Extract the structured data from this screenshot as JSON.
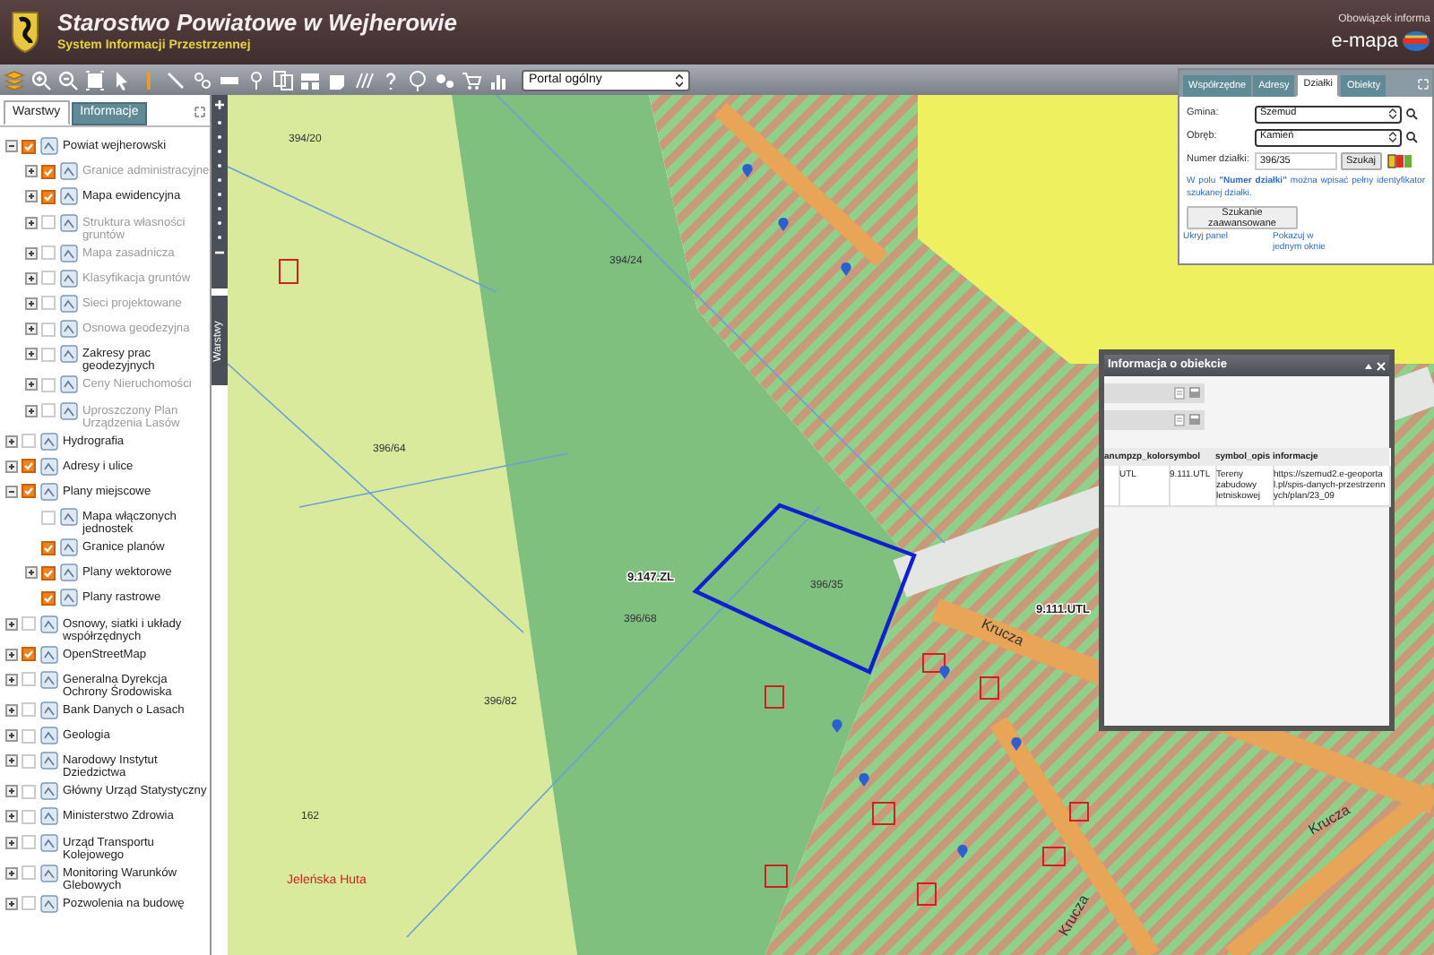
{
  "header": {
    "title": "Starostwo Powiatowe w Wejherowie",
    "subtitle": "System Informacji Przestrzennej",
    "notice": "Obowiązek informa",
    "brand": "e-mapa"
  },
  "toolbar": {
    "portal_select": "Portal ogólny"
  },
  "layer_panel": {
    "tabs": [
      {
        "label": "Warstwy",
        "selected": true
      },
      {
        "label": "Informacje",
        "selected": false
      }
    ],
    "layers": [
      {
        "label": "Powiat wejherowski",
        "checked": true,
        "disabled": false,
        "expandable": true,
        "expanded": true,
        "children": [
          {
            "label": "Granice administracyjne",
            "checked": true,
            "disabled": true,
            "expandable": true,
            "expanded": false
          },
          {
            "label": "Mapa ewidencyjna",
            "checked": true,
            "disabled": false,
            "expandable": true,
            "expanded": false
          },
          {
            "label": "Struktura własności gruntów",
            "checked": false,
            "disabled": true,
            "expandable": true,
            "expanded": false
          },
          {
            "label": "Mapa zasadnicza",
            "checked": false,
            "disabled": true,
            "expandable": true,
            "expanded": false
          },
          {
            "label": "Klasyfikacja gruntów",
            "checked": false,
            "disabled": true,
            "expandable": true,
            "expanded": false
          },
          {
            "label": "Sieci projektowane",
            "checked": false,
            "disabled": true,
            "expandable": true,
            "expanded": false
          },
          {
            "label": "Osnowa geodezyjna",
            "checked": false,
            "disabled": true,
            "expandable": true,
            "expanded": false
          },
          {
            "label": "Zakresy prac geodezyjnych",
            "checked": false,
            "disabled": false,
            "expandable": true,
            "expanded": false
          },
          {
            "label": "Ceny Nieruchomości",
            "checked": false,
            "disabled": true,
            "expandable": true,
            "expanded": false
          },
          {
            "label": "Uproszczony Plan Urządzenia Lasów",
            "checked": false,
            "disabled": true,
            "expandable": true,
            "expanded": false
          }
        ]
      },
      {
        "label": "Hydrografia",
        "checked": false,
        "disabled": false,
        "expandable": true,
        "expanded": false
      },
      {
        "label": "Adresy i ulice",
        "checked": true,
        "disabled": false,
        "expandable": true,
        "expanded": false
      },
      {
        "label": "Plany miejscowe",
        "checked": true,
        "disabled": false,
        "expandable": true,
        "expanded": true,
        "children": [
          {
            "label": "Mapa włączonych jednostek",
            "checked": false,
            "disabled": false,
            "expandable": false
          },
          {
            "label": "Granice planów",
            "checked": true,
            "disabled": false,
            "expandable": false
          },
          {
            "label": "Plany wektorowe",
            "checked": true,
            "disabled": false,
            "expandable": true,
            "expanded": false
          },
          {
            "label": "Plany rastrowe",
            "checked": true,
            "disabled": false,
            "expandable": false
          }
        ]
      },
      {
        "label": "Osnowy, siatki i układy współrzędnych",
        "checked": false,
        "disabled": false,
        "expandable": true,
        "expanded": false
      },
      {
        "label": "OpenStreetMap",
        "checked": true,
        "disabled": false,
        "expandable": true,
        "expanded": false
      },
      {
        "label": "Generalna Dyrekcja Ochrony Środowiska",
        "checked": false,
        "disabled": false,
        "expandable": true,
        "expanded": false
      },
      {
        "label": "Bank Danych o Lasach",
        "checked": false,
        "disabled": false,
        "expandable": true,
        "expanded": false
      },
      {
        "label": "Geologia",
        "checked": false,
        "disabled": false,
        "expandable": true,
        "expanded": false
      },
      {
        "label": "Narodowy Instytut Dziedzictwa",
        "checked": false,
        "disabled": false,
        "expandable": true,
        "expanded": false
      },
      {
        "label": "Główny Urząd Statystyczny",
        "checked": false,
        "disabled": false,
        "expandable": true,
        "expanded": false
      },
      {
        "label": "Ministerstwo Zdrowia",
        "checked": false,
        "disabled": false,
        "expandable": true,
        "expanded": false
      },
      {
        "label": "Urząd Transportu Kolejowego",
        "checked": false,
        "disabled": false,
        "expandable": true,
        "expanded": false
      },
      {
        "label": "Monitoring Warunków Glebowych",
        "checked": false,
        "disabled": false,
        "expandable": true,
        "expanded": false
      },
      {
        "label": "Pozwolenia na budowę",
        "checked": false,
        "disabled": false,
        "expandable": true,
        "expanded": false
      }
    ]
  },
  "side_tab": "Warstwy",
  "map": {
    "labels": [
      {
        "text": "394/20",
        "kind": "parcel"
      },
      {
        "text": "394/24",
        "kind": "parcel"
      },
      {
        "text": "396/64",
        "kind": "parcel"
      },
      {
        "text": "396/82",
        "kind": "parcel"
      },
      {
        "text": "396/35",
        "kind": "parcel"
      },
      {
        "text": "9.147.ZL",
        "kind": "zone"
      },
      {
        "text": "396/68",
        "kind": "parcel"
      },
      {
        "text": "162",
        "kind": "parcel"
      },
      {
        "text": "Jeleńska Huta",
        "kind": "place"
      },
      {
        "text": "Krucza",
        "kind": "street"
      },
      {
        "text": "9.111.UTL",
        "kind": "zone"
      },
      {
        "text": "Krucza",
        "kind": "street"
      },
      {
        "text": "Krucza",
        "kind": "street"
      }
    ]
  },
  "search_panel": {
    "tabs": [
      {
        "label": "Współrzędne",
        "selected": false
      },
      {
        "label": "Adresy",
        "selected": false
      },
      {
        "label": "Działki",
        "selected": true
      },
      {
        "label": "Obiekty",
        "selected": false
      }
    ],
    "fields": [
      {
        "label": "Gmina:",
        "value": "Szemud",
        "kind": "select"
      },
      {
        "label": "Obręb:",
        "value": "Kamień",
        "kind": "select"
      },
      {
        "label": "Numer działki:",
        "value": "396/35",
        "kind": "input"
      }
    ],
    "search_button": "Szukaj",
    "hint": "W polu **\"Numer działki\"** można wpisać pełny identyfikator szukanej działki.",
    "advanced_button": "Szukanie zaawansowane",
    "links": [
      "Ukryj panel",
      "Pokazuj w jednym oknie"
    ]
  },
  "info_window": {
    "title": "Informacja o obiekcie",
    "columns": [
      "anu",
      "mpzp_kolor",
      "symbol",
      "symbol_opis",
      "informacje"
    ],
    "rows": [
      {
        "cells": [
          "",
          "UTL",
          "9.111.UTL",
          "Tereny zabudowy letniskowej",
          "https://szemud2.e-geoportal.pl/spis-danych-przestrzennych/plan/23_09"
        ]
      }
    ]
  }
}
